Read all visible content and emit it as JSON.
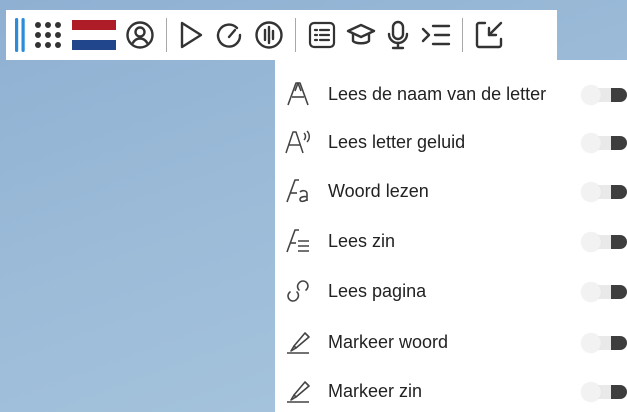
{
  "toolbar": {
    "language_flag_colors": [
      "#ae1c28",
      "#ffffff",
      "#21468b"
    ],
    "icons": [
      "drag-handle-icon",
      "apps-grid-icon",
      "language-flag",
      "profile-icon",
      "play-icon",
      "speed-icon",
      "voice-icon",
      "text-options-icon",
      "education-icon",
      "microphone-icon",
      "indent-icon",
      "collapse-icon"
    ],
    "accent_color": "#2e8bd9"
  },
  "menu": {
    "items": [
      {
        "label": "Lees de naam van de letter",
        "icon": "letter-a-icon",
        "enabled": false
      },
      {
        "label": "Lees letter geluid",
        "icon": "letter-sound-icon",
        "enabled": false
      },
      {
        "label": "Woord lezen",
        "icon": "read-word-icon",
        "enabled": false
      },
      {
        "label": "Lees zin",
        "icon": "read-sentence-icon",
        "enabled": false
      },
      {
        "label": "Lees pagina",
        "icon": "link-icon",
        "enabled": false
      },
      {
        "label": "Markeer woord",
        "icon": "highlighter-icon",
        "enabled": false
      },
      {
        "label": "Markeer zin",
        "icon": "highlighter-icon",
        "enabled": false
      }
    ]
  }
}
